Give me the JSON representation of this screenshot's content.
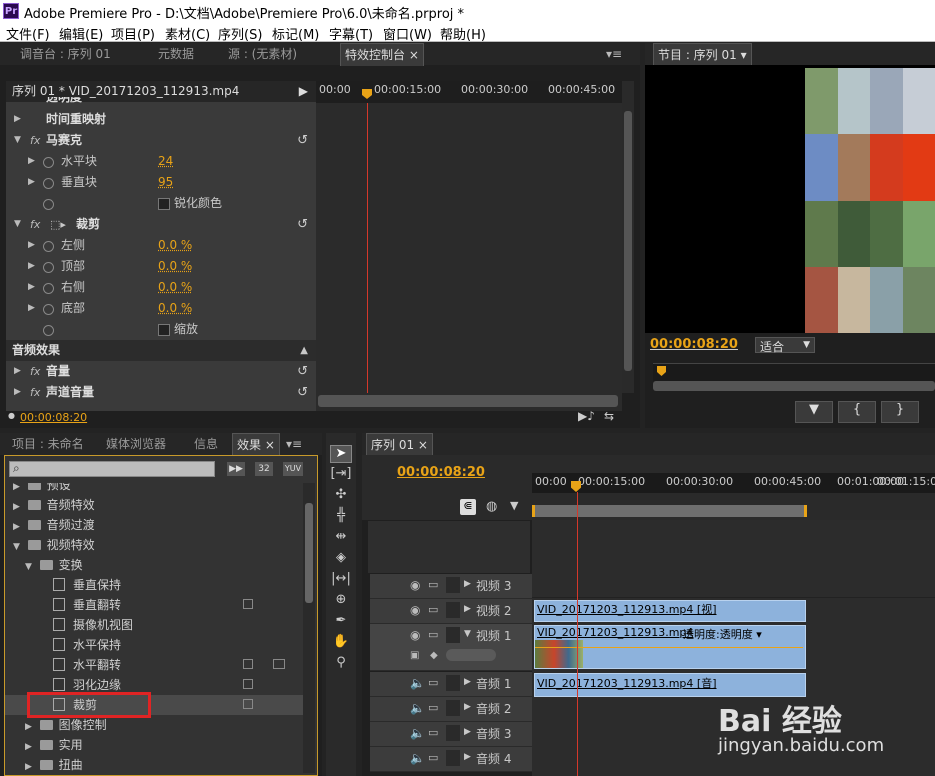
{
  "app": {
    "title": "Adobe Premiere Pro - D:\\文档\\Adobe\\Premiere Pro\\6.0\\未命名.prproj *",
    "logo": "Pr"
  },
  "menu": [
    "文件(F)",
    "编辑(E)",
    "项目(P)",
    "素材(C)",
    "序列(S)",
    "标记(M)",
    "字幕(T)",
    "窗口(W)",
    "帮助(H)"
  ],
  "effect_controls": {
    "tabs": [
      "调音台 : 序列 01",
      "元数据",
      "源 : (无素材)",
      "特效控制台"
    ],
    "clip_header": "序列 01 * VID_20171203_112913.mp4",
    "ruler": [
      "00:00",
      "00:00:15:00",
      "00:00:30:00",
      "00:00:45:00"
    ],
    "rows": {
      "partial_top": "透明度",
      "time_remap": "时间重映射",
      "mosaic": "马赛克",
      "h_blocks_label": "水平块",
      "h_blocks_value": "24",
      "v_blocks_label": "垂直块",
      "v_blocks_value": "95",
      "sharpen_label": "锐化颜色",
      "crop": "裁剪",
      "left_label": "左侧",
      "left_value": "0.0 %",
      "top_label": "顶部",
      "top_value": "0.0 %",
      "right_label": "右侧",
      "right_value": "0.0 %",
      "bottom_label": "底部",
      "bottom_value": "0.0 %",
      "zoom_label": "缩放",
      "audio_effects": "音频效果",
      "volume": "音量",
      "channel_volume": "声道音量"
    },
    "timecode": "00:00:08:20"
  },
  "program": {
    "tab": "节目 : 序列 01",
    "timecode": "00:00:08:20",
    "fit": "适合",
    "buttons": [
      "▼",
      "{",
      "}"
    ],
    "mosaic_colors": [
      "#7f9a6b",
      "#b5c5c9",
      "#9aa7b8",
      "#c6cdd6",
      "#6d8cc4",
      "#a37a5b",
      "#d43b1e",
      "#e23a14",
      "#5f7a4c",
      "#3f5b39",
      "#4e6d43",
      "#79a56b",
      "#a55542",
      "#c7b79e",
      "#8aa0a8",
      "#6d8560"
    ]
  },
  "project": {
    "tabs": [
      "项目 : 未命名",
      "媒体浏览器",
      "信息",
      "效果"
    ],
    "search_placeholder": "",
    "filters": [
      "32",
      "YUV"
    ],
    "tree": [
      {
        "label": "预设",
        "level": 0,
        "kind": "folder"
      },
      {
        "label": "音频特效",
        "level": 0,
        "kind": "folder"
      },
      {
        "label": "音频过渡",
        "level": 0,
        "kind": "folder"
      },
      {
        "label": "视频特效",
        "level": 0,
        "kind": "folder"
      },
      {
        "label": "变换",
        "level": 1,
        "kind": "folder"
      },
      {
        "label": "垂直保持",
        "level": 2,
        "kind": "fx"
      },
      {
        "label": "垂直翻转",
        "level": 2,
        "kind": "fx"
      },
      {
        "label": "摄像机视图",
        "level": 2,
        "kind": "fx"
      },
      {
        "label": "水平保持",
        "level": 2,
        "kind": "fx"
      },
      {
        "label": "水平翻转",
        "level": 2,
        "kind": "fx"
      },
      {
        "label": "羽化边缘",
        "level": 2,
        "kind": "fx"
      },
      {
        "label": "裁剪",
        "level": 2,
        "kind": "fx"
      },
      {
        "label": "图像控制",
        "level": 1,
        "kind": "folder"
      },
      {
        "label": "实用",
        "level": 1,
        "kind": "folder"
      },
      {
        "label": "扭曲",
        "level": 1,
        "kind": "folder"
      }
    ]
  },
  "timeline": {
    "tab": "序列 01",
    "timecode": "00:00:08:20",
    "ruler": [
      "00:00",
      "00:00:15:00",
      "00:00:30:00",
      "00:00:45:00",
      "00:01:00:00",
      "00:01:15:00"
    ],
    "tracks": {
      "v3": "视频 3",
      "v2": "视频 2",
      "v1": "视频 1",
      "a1": "音频 1",
      "a2": "音频 2",
      "a3": "音频 3",
      "a4": "音频 4"
    },
    "clip_v2": "VID_20171203_112913.mp4 [视]",
    "clip_v1": "VID_20171203_112913.mp4",
    "clip_v1_opacity": "透明度:透明度 ▾",
    "clip_a1": "VID_20171203_112913.mp4 [音]"
  },
  "watermark": {
    "brand": "Bai 经验",
    "url": "jingyan.baidu.com"
  },
  "colors": {
    "accent": "#e8a317",
    "highlight_box": "#e02424",
    "playhead": "#d4382b"
  }
}
